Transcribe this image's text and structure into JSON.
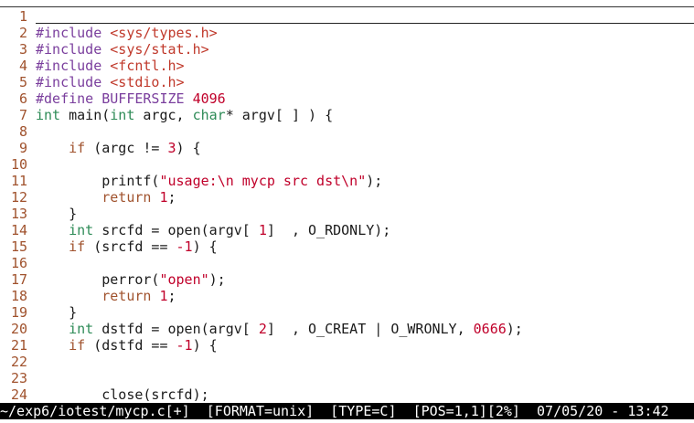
{
  "colors": {
    "background": "#ffffff",
    "line_number": "#a0522d",
    "preprocessor": "#7a3e9d",
    "include_path": "#c0392b",
    "type": "#2e8b57",
    "keyword": "#a0522d",
    "string": "#c0002a",
    "statusbar_bg": "#000000",
    "statusbar_fg": "#ffffff"
  },
  "editor": {
    "cursor_line": 1,
    "lines": [
      {
        "num": "1",
        "tokens": []
      },
      {
        "num": "2",
        "tokens": [
          {
            "t": "#include ",
            "c": "pre"
          },
          {
            "t": "<sys/types.h>",
            "c": "inc"
          }
        ]
      },
      {
        "num": "3",
        "tokens": [
          {
            "t": "#include ",
            "c": "pre"
          },
          {
            "t": "<sys/stat.h>",
            "c": "inc"
          }
        ]
      },
      {
        "num": "4",
        "tokens": [
          {
            "t": "#include ",
            "c": "pre"
          },
          {
            "t": "<fcntl.h>",
            "c": "inc"
          }
        ]
      },
      {
        "num": "5",
        "tokens": [
          {
            "t": "#include ",
            "c": "pre"
          },
          {
            "t": "<stdio.h>",
            "c": "inc"
          }
        ]
      },
      {
        "num": "6",
        "tokens": [
          {
            "t": "#define BUFFERSIZE ",
            "c": "pre"
          },
          {
            "t": "4096",
            "c": "num"
          }
        ]
      },
      {
        "num": "7",
        "tokens": [
          {
            "t": "int",
            "c": "type"
          },
          {
            "t": " main(",
            "c": "plain"
          },
          {
            "t": "int",
            "c": "type"
          },
          {
            "t": " argc, ",
            "c": "plain"
          },
          {
            "t": "char",
            "c": "type"
          },
          {
            "t": "* argv[ ] ) {",
            "c": "plain"
          }
        ]
      },
      {
        "num": "8",
        "tokens": []
      },
      {
        "num": "9",
        "tokens": [
          {
            "t": "    ",
            "c": "plain"
          },
          {
            "t": "if",
            "c": "kw"
          },
          {
            "t": " (argc != ",
            "c": "plain"
          },
          {
            "t": "3",
            "c": "num"
          },
          {
            "t": ") {",
            "c": "plain"
          }
        ]
      },
      {
        "num": "10",
        "tokens": []
      },
      {
        "num": "11",
        "tokens": [
          {
            "t": "        printf(",
            "c": "plain"
          },
          {
            "t": "\"usage:",
            "c": "str"
          },
          {
            "t": "\\n",
            "c": "esc"
          },
          {
            "t": " mycp src dst",
            "c": "str"
          },
          {
            "t": "\\n",
            "c": "esc"
          },
          {
            "t": "\"",
            "c": "str"
          },
          {
            "t": ");",
            "c": "plain"
          }
        ]
      },
      {
        "num": "12",
        "tokens": [
          {
            "t": "        ",
            "c": "plain"
          },
          {
            "t": "return",
            "c": "kw"
          },
          {
            "t": " ",
            "c": "plain"
          },
          {
            "t": "1",
            "c": "num"
          },
          {
            "t": ";",
            "c": "plain"
          }
        ]
      },
      {
        "num": "13",
        "tokens": [
          {
            "t": "    }",
            "c": "plain"
          }
        ]
      },
      {
        "num": "14",
        "tokens": [
          {
            "t": "    ",
            "c": "plain"
          },
          {
            "t": "int",
            "c": "type"
          },
          {
            "t": " srcfd = open(argv[ ",
            "c": "plain"
          },
          {
            "t": "1",
            "c": "num"
          },
          {
            "t": "]  , O_RDONLY);",
            "c": "plain"
          }
        ]
      },
      {
        "num": "15",
        "tokens": [
          {
            "t": "    ",
            "c": "plain"
          },
          {
            "t": "if",
            "c": "kw"
          },
          {
            "t": " (srcfd == ",
            "c": "plain"
          },
          {
            "t": "-1",
            "c": "num"
          },
          {
            "t": ") {",
            "c": "plain"
          }
        ]
      },
      {
        "num": "16",
        "tokens": []
      },
      {
        "num": "17",
        "tokens": [
          {
            "t": "        perror(",
            "c": "plain"
          },
          {
            "t": "\"open\"",
            "c": "str"
          },
          {
            "t": ");",
            "c": "plain"
          }
        ]
      },
      {
        "num": "18",
        "tokens": [
          {
            "t": "        ",
            "c": "plain"
          },
          {
            "t": "return",
            "c": "kw"
          },
          {
            "t": " ",
            "c": "plain"
          },
          {
            "t": "1",
            "c": "num"
          },
          {
            "t": ";",
            "c": "plain"
          }
        ]
      },
      {
        "num": "19",
        "tokens": [
          {
            "t": "    }",
            "c": "plain"
          }
        ]
      },
      {
        "num": "20",
        "tokens": [
          {
            "t": "    ",
            "c": "plain"
          },
          {
            "t": "int",
            "c": "type"
          },
          {
            "t": " dstfd = open(argv[ ",
            "c": "plain"
          },
          {
            "t": "2",
            "c": "num"
          },
          {
            "t": "]  , O_CREAT | O_WRONLY, ",
            "c": "plain"
          },
          {
            "t": "0666",
            "c": "num"
          },
          {
            "t": ");",
            "c": "plain"
          }
        ]
      },
      {
        "num": "21",
        "tokens": [
          {
            "t": "    ",
            "c": "plain"
          },
          {
            "t": "if",
            "c": "kw"
          },
          {
            "t": " (dstfd == ",
            "c": "plain"
          },
          {
            "t": "-1",
            "c": "num"
          },
          {
            "t": ") {",
            "c": "plain"
          }
        ]
      },
      {
        "num": "22",
        "tokens": []
      },
      {
        "num": "23",
        "tokens": []
      },
      {
        "num": "24",
        "tokens": [
          {
            "t": "        close(srcfd);",
            "c": "plain"
          }
        ]
      }
    ]
  },
  "statusline": {
    "path": "~/exp6/iotest/mycp.c[+]",
    "format": "[FORMAT=unix]",
    "type": "[TYPE=C]",
    "pos": "[POS=1,1]",
    "percent": "[2%]",
    "datetime": "07/05/20 - 13:42"
  }
}
